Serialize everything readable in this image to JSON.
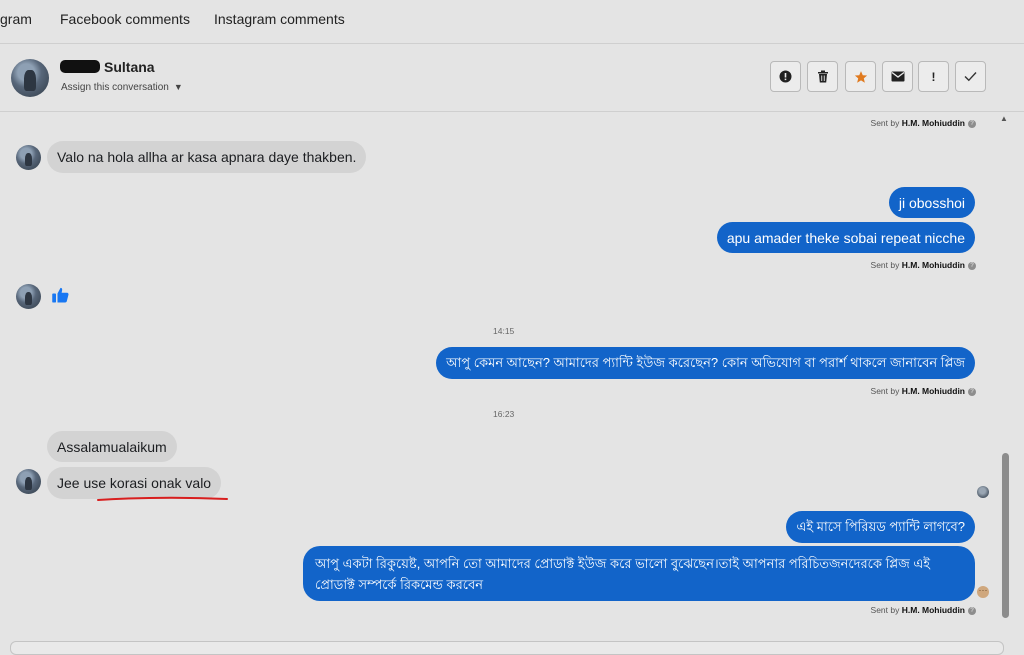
{
  "tabs": [
    {
      "label": "gram"
    },
    {
      "label": "Facebook comments"
    },
    {
      "label": "Instagram comments"
    }
  ],
  "conversation": {
    "name": "Sultana",
    "assign_label": "Assign this conversation",
    "actions": [
      {
        "name": "report-spam-icon",
        "glyph": "●"
      },
      {
        "name": "trash-icon",
        "glyph": "🗑"
      },
      {
        "name": "star-icon",
        "glyph": "★"
      },
      {
        "name": "envelope-icon",
        "glyph": "✉"
      },
      {
        "name": "exclamation-icon",
        "glyph": "!"
      },
      {
        "name": "checkmark-icon",
        "glyph": "✓"
      }
    ]
  },
  "messages": {
    "sent_by_prefix": "Sent by",
    "agent": "H.M. Mohiuddin",
    "m1": "Valo na hola allha ar kasa apnara daye thakben.",
    "m2": "ji obosshoi",
    "m3": "apu amader theke sobai repeat nicche",
    "ts1": "14:15",
    "m4": "আপু কেমন আছেন? আমাদের প্যান্টি ইউজ করেছেন? কোন অভিযোগ বা পরার্শ থাকলে জানাবেন প্লিজ",
    "ts2": "16:23",
    "m5": "Assalamualaikum",
    "m6": "Jee use korasi onak valo",
    "m7": "এই মাসে পিরিয়ড প্যান্টি লাগবে?",
    "m8": "আপু একটা রিকুয়েষ্ট, আপনি তো আমাদের প্রোডাক্ট ইউজ করে ভালো বুঝেছেন।তাই আপনার পরিচিতজনদেরকে প্লিজ এই প্রোডাক্ট সম্পর্কে রিকমেন্ড করবেন"
  },
  "colors": {
    "outgoing_bubble": "#1264c9",
    "incoming_bubble": "#d3d3d3",
    "like_icon": "#1877f2",
    "star_icon": "#e07a1f",
    "underline": "#d81f1f"
  }
}
